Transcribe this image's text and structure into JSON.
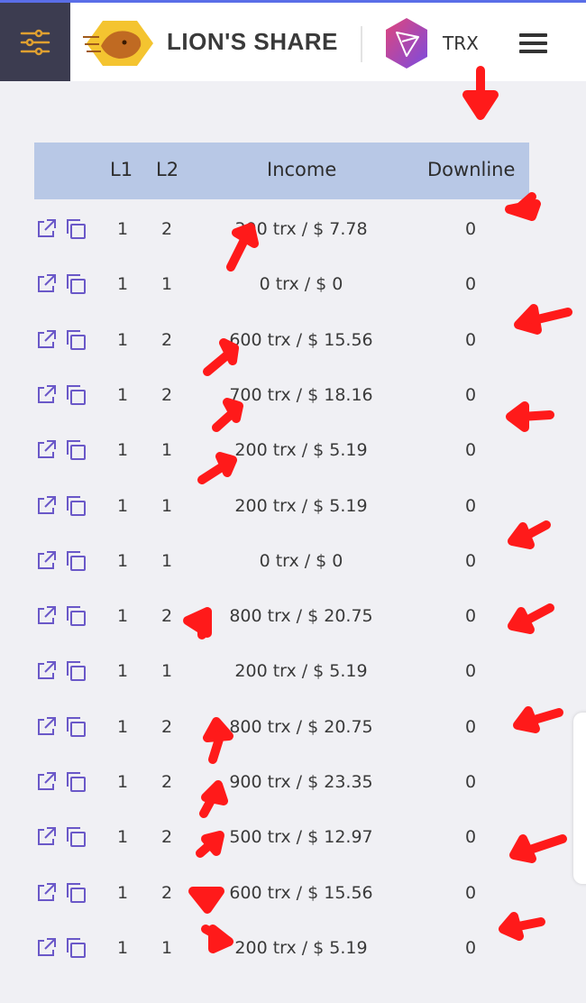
{
  "header": {
    "brand": "LION'S SHARE",
    "currency": "TRX",
    "menu_icon": "sliders-icon",
    "nav_icon": "hamburger-icon"
  },
  "table": {
    "columns": [
      "",
      "L1",
      "L2",
      "Income",
      "Downline"
    ],
    "rows": [
      {
        "l1": "1",
        "l2": "2",
        "income": "300 trx / $ 7.78",
        "downline": "0"
      },
      {
        "l1": "1",
        "l2": "1",
        "income": "0 trx / $ 0",
        "downline": "0"
      },
      {
        "l1": "1",
        "l2": "2",
        "income": "600 trx / $ 15.56",
        "downline": "0"
      },
      {
        "l1": "1",
        "l2": "2",
        "income": "700 trx / $ 18.16",
        "downline": "0"
      },
      {
        "l1": "1",
        "l2": "1",
        "income": "200 trx / $ 5.19",
        "downline": "0"
      },
      {
        "l1": "1",
        "l2": "1",
        "income": "200 trx / $ 5.19",
        "downline": "0"
      },
      {
        "l1": "1",
        "l2": "1",
        "income": "0 trx / $ 0",
        "downline": "0"
      },
      {
        "l1": "1",
        "l2": "2",
        "income": "800 trx / $ 20.75",
        "downline": "0"
      },
      {
        "l1": "1",
        "l2": "1",
        "income": "200 trx / $ 5.19",
        "downline": "0"
      },
      {
        "l1": "1",
        "l2": "2",
        "income": "800 trx / $ 20.75",
        "downline": "0"
      },
      {
        "l1": "1",
        "l2": "2",
        "income": "900 trx / $ 23.35",
        "downline": "0"
      },
      {
        "l1": "1",
        "l2": "2",
        "income": "500 trx / $ 12.97",
        "downline": "0"
      },
      {
        "l1": "1",
        "l2": "2",
        "income": "600 trx / $ 15.56",
        "downline": "0"
      },
      {
        "l1": "1",
        "l2": "1",
        "income": "200 trx / $ 5.19",
        "downline": "0"
      }
    ]
  },
  "colors": {
    "accent": "#6a58c8",
    "header_row": "#b8c8e6",
    "annotation": "#ff1a1a"
  }
}
